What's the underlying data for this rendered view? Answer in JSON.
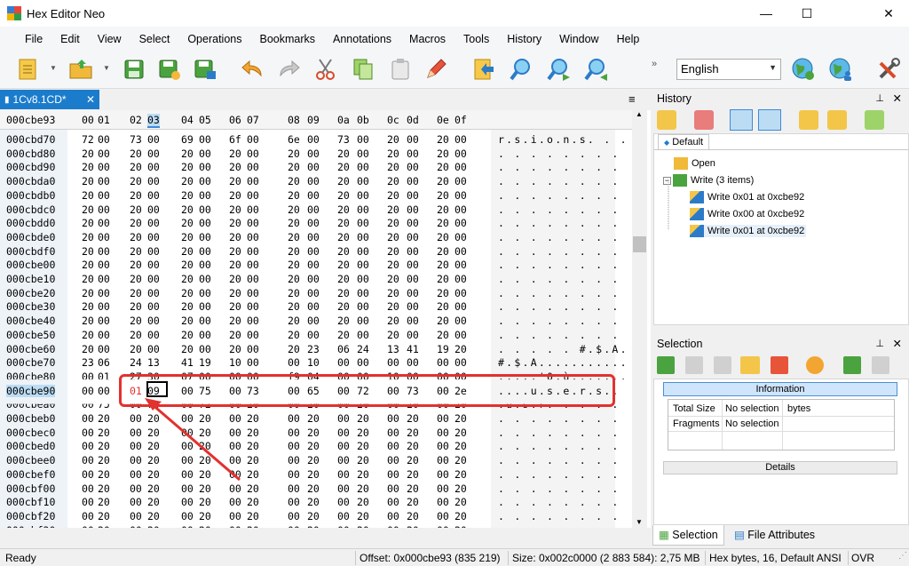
{
  "window": {
    "title": "Hex Editor Neo",
    "minimize": "—",
    "maximize": "☐",
    "close": "✕"
  },
  "menu": [
    "File",
    "Edit",
    "View",
    "Select",
    "Operations",
    "Bookmarks",
    "Annotations",
    "Macros",
    "Tools",
    "History",
    "Window",
    "Help"
  ],
  "language": "English",
  "doc_tab": {
    "label": "1Cv8.1CD*",
    "close": "✕"
  },
  "hex": {
    "current_offset": "000cbe93",
    "columns": [
      "00",
      "01",
      "02",
      "03",
      "04",
      "05",
      "06",
      "07",
      "08",
      "09",
      "0a",
      "0b",
      "0c",
      "0d",
      "0e",
      "0f"
    ],
    "selected_column": 3,
    "rows": [
      {
        "off": "000cbd70",
        "bytes": [
          "72",
          "00",
          "73",
          "00",
          "69",
          "00",
          "6f",
          "00",
          "6e",
          "00",
          "73",
          "00",
          "20",
          "00",
          "20",
          "00"
        ],
        "ascii": "r.s.i.o.n.s. . ."
      },
      {
        "off": "000cbd80",
        "bytes": [
          "20",
          "00",
          "20",
          "00",
          "20",
          "00",
          "20",
          "00",
          "20",
          "00",
          "20",
          "00",
          "20",
          "00",
          "20",
          "00"
        ],
        "ascii": ". . . . . . . . "
      },
      {
        "off": "000cbd90",
        "bytes": [
          "20",
          "00",
          "20",
          "00",
          "20",
          "00",
          "20",
          "00",
          "20",
          "00",
          "20",
          "00",
          "20",
          "00",
          "20",
          "00"
        ],
        "ascii": ". . . . . . . . "
      },
      {
        "off": "000cbda0",
        "bytes": [
          "20",
          "00",
          "20",
          "00",
          "20",
          "00",
          "20",
          "00",
          "20",
          "00",
          "20",
          "00",
          "20",
          "00",
          "20",
          "00"
        ],
        "ascii": ". . . . . . . . "
      },
      {
        "off": "000cbdb0",
        "bytes": [
          "20",
          "00",
          "20",
          "00",
          "20",
          "00",
          "20",
          "00",
          "20",
          "00",
          "20",
          "00",
          "20",
          "00",
          "20",
          "00"
        ],
        "ascii": ". . . . . . . . "
      },
      {
        "off": "000cbdc0",
        "bytes": [
          "20",
          "00",
          "20",
          "00",
          "20",
          "00",
          "20",
          "00",
          "20",
          "00",
          "20",
          "00",
          "20",
          "00",
          "20",
          "00"
        ],
        "ascii": ". . . . . . . . "
      },
      {
        "off": "000cbdd0",
        "bytes": [
          "20",
          "00",
          "20",
          "00",
          "20",
          "00",
          "20",
          "00",
          "20",
          "00",
          "20",
          "00",
          "20",
          "00",
          "20",
          "00"
        ],
        "ascii": ". . . . . . . . "
      },
      {
        "off": "000cbde0",
        "bytes": [
          "20",
          "00",
          "20",
          "00",
          "20",
          "00",
          "20",
          "00",
          "20",
          "00",
          "20",
          "00",
          "20",
          "00",
          "20",
          "00"
        ],
        "ascii": ". . . . . . . . "
      },
      {
        "off": "000cbdf0",
        "bytes": [
          "20",
          "00",
          "20",
          "00",
          "20",
          "00",
          "20",
          "00",
          "20",
          "00",
          "20",
          "00",
          "20",
          "00",
          "20",
          "00"
        ],
        "ascii": ". . . . . . . . "
      },
      {
        "off": "000cbe00",
        "bytes": [
          "20",
          "00",
          "20",
          "00",
          "20",
          "00",
          "20",
          "00",
          "20",
          "00",
          "20",
          "00",
          "20",
          "00",
          "20",
          "00"
        ],
        "ascii": ". . . . . . . . "
      },
      {
        "off": "000cbe10",
        "bytes": [
          "20",
          "00",
          "20",
          "00",
          "20",
          "00",
          "20",
          "00",
          "20",
          "00",
          "20",
          "00",
          "20",
          "00",
          "20",
          "00"
        ],
        "ascii": ". . . . . . . . "
      },
      {
        "off": "000cbe20",
        "bytes": [
          "20",
          "00",
          "20",
          "00",
          "20",
          "00",
          "20",
          "00",
          "20",
          "00",
          "20",
          "00",
          "20",
          "00",
          "20",
          "00"
        ],
        "ascii": ". . . . . . . . "
      },
      {
        "off": "000cbe30",
        "bytes": [
          "20",
          "00",
          "20",
          "00",
          "20",
          "00",
          "20",
          "00",
          "20",
          "00",
          "20",
          "00",
          "20",
          "00",
          "20",
          "00"
        ],
        "ascii": ". . . . . . . . "
      },
      {
        "off": "000cbe40",
        "bytes": [
          "20",
          "00",
          "20",
          "00",
          "20",
          "00",
          "20",
          "00",
          "20",
          "00",
          "20",
          "00",
          "20",
          "00",
          "20",
          "00"
        ],
        "ascii": ". . . . . . . . "
      },
      {
        "off": "000cbe50",
        "bytes": [
          "20",
          "00",
          "20",
          "00",
          "20",
          "00",
          "20",
          "00",
          "20",
          "00",
          "20",
          "00",
          "20",
          "00",
          "20",
          "00"
        ],
        "ascii": ". . . . . . . . "
      },
      {
        "off": "000cbe60",
        "bytes": [
          "20",
          "00",
          "20",
          "00",
          "20",
          "00",
          "20",
          "00",
          "20",
          "23",
          "06",
          "24",
          "13",
          "41",
          "19",
          "20"
        ],
        "ascii": ". . . . . #.$.A. "
      },
      {
        "off": "000cbe70",
        "bytes": [
          "23",
          "06",
          "24",
          "13",
          "41",
          "19",
          "10",
          "00",
          "00",
          "10",
          "00",
          "00",
          "00",
          "00",
          "00",
          "00"
        ],
        "ascii": "#.$.A..........."
      },
      {
        "off": "000cbe80",
        "bytes": [
          "00",
          "01",
          "27",
          "30",
          "07",
          "00",
          "00",
          "00",
          "f9",
          "04",
          "00",
          "00",
          "10",
          "00",
          "00",
          "00"
        ],
        "ascii": ".....'0.ù.......",
        "cut": true
      },
      {
        "off": "000cbe90",
        "bytes": [
          "00",
          "00",
          "01",
          "09",
          "00",
          "75",
          "00",
          "73",
          "00",
          "65",
          "00",
          "72",
          "00",
          "73",
          "00",
          "2e"
        ],
        "ascii": "....u.s.e.r.s..",
        "cur": true
      },
      {
        "off": "000cbea0",
        "bytes": [
          "00",
          "75",
          "00",
          "73",
          "00",
          "72",
          "00",
          "20",
          "00",
          "20",
          "00",
          "20",
          "00",
          "20",
          "00",
          "20"
        ],
        "ascii": ".u.s.r. . . . . ",
        "cut": true
      },
      {
        "off": "000cbeb0",
        "bytes": [
          "00",
          "20",
          "00",
          "20",
          "00",
          "20",
          "00",
          "20",
          "00",
          "20",
          "00",
          "20",
          "00",
          "20",
          "00",
          "20"
        ],
        "ascii": ". . . . . . . . "
      },
      {
        "off": "000cbec0",
        "bytes": [
          "00",
          "20",
          "00",
          "20",
          "00",
          "20",
          "00",
          "20",
          "00",
          "20",
          "00",
          "20",
          "00",
          "20",
          "00",
          "20"
        ],
        "ascii": ". . . . . . . . "
      },
      {
        "off": "000cbed0",
        "bytes": [
          "00",
          "20",
          "00",
          "20",
          "00",
          "20",
          "00",
          "20",
          "00",
          "20",
          "00",
          "20",
          "00",
          "20",
          "00",
          "20"
        ],
        "ascii": ". . . . . . . . "
      },
      {
        "off": "000cbee0",
        "bytes": [
          "00",
          "20",
          "00",
          "20",
          "00",
          "20",
          "00",
          "20",
          "00",
          "20",
          "00",
          "20",
          "00",
          "20",
          "00",
          "20"
        ],
        "ascii": ". . . . . . . . "
      },
      {
        "off": "000cbef0",
        "bytes": [
          "00",
          "20",
          "00",
          "20",
          "00",
          "20",
          "00",
          "20",
          "00",
          "20",
          "00",
          "20",
          "00",
          "20",
          "00",
          "20"
        ],
        "ascii": ". . . . . . . . "
      },
      {
        "off": "000cbf00",
        "bytes": [
          "00",
          "20",
          "00",
          "20",
          "00",
          "20",
          "00",
          "20",
          "00",
          "20",
          "00",
          "20",
          "00",
          "20",
          "00",
          "20"
        ],
        "ascii": ". . . . . . . . "
      },
      {
        "off": "000cbf10",
        "bytes": [
          "00",
          "20",
          "00",
          "20",
          "00",
          "20",
          "00",
          "20",
          "00",
          "20",
          "00",
          "20",
          "00",
          "20",
          "00",
          "20"
        ],
        "ascii": ". . . . . . . . "
      },
      {
        "off": "000cbf20",
        "bytes": [
          "00",
          "20",
          "00",
          "20",
          "00",
          "20",
          "00",
          "20",
          "00",
          "20",
          "00",
          "20",
          "00",
          "20",
          "00",
          "20"
        ],
        "ascii": ". . . . . . . . "
      },
      {
        "off": "000cbf30",
        "bytes": [
          "00",
          "20",
          "00",
          "20",
          "00",
          "20",
          "00",
          "20",
          "00",
          "20",
          "00",
          "20",
          "00",
          "20",
          "00",
          "20"
        ],
        "ascii": ". . . . . . . . "
      }
    ]
  },
  "history": {
    "title": "History",
    "tab": "Default",
    "items": [
      {
        "label": "Open",
        "icon": "folder-open-icon"
      },
      {
        "label": "Write (3 items)",
        "icon": "write-group-icon"
      },
      {
        "label": "Write 0x01 at 0xcbe92",
        "icon": "pencil-icon"
      },
      {
        "label": "Write 0x00 at 0xcbe92",
        "icon": "pencil-icon"
      },
      {
        "label": "Write 0x01 at 0xcbe92",
        "icon": "pencil-icon"
      }
    ]
  },
  "selection": {
    "title": "Selection",
    "info_label": "Information",
    "details_label": "Details",
    "total_size_label": "Total Size",
    "total_size_value": "No selection",
    "total_size_unit": "bytes",
    "fragments_label": "Fragments",
    "fragments_value": "No selection"
  },
  "bottom_tabs": {
    "selection": "Selection",
    "file_attributes": "File Attributes"
  },
  "status": {
    "ready": "Ready",
    "offset": "Offset: 0x000cbe93 (835 219)",
    "size": "Size: 0x002c0000 (2 883 584): 2,75 MB",
    "mode": "Hex bytes, 16, Default ANSI",
    "ovr": "OVR"
  },
  "colors": {
    "accent": "#1c7ccc",
    "highlight_box": "#e2312f",
    "modified_byte": "#e2312f"
  }
}
